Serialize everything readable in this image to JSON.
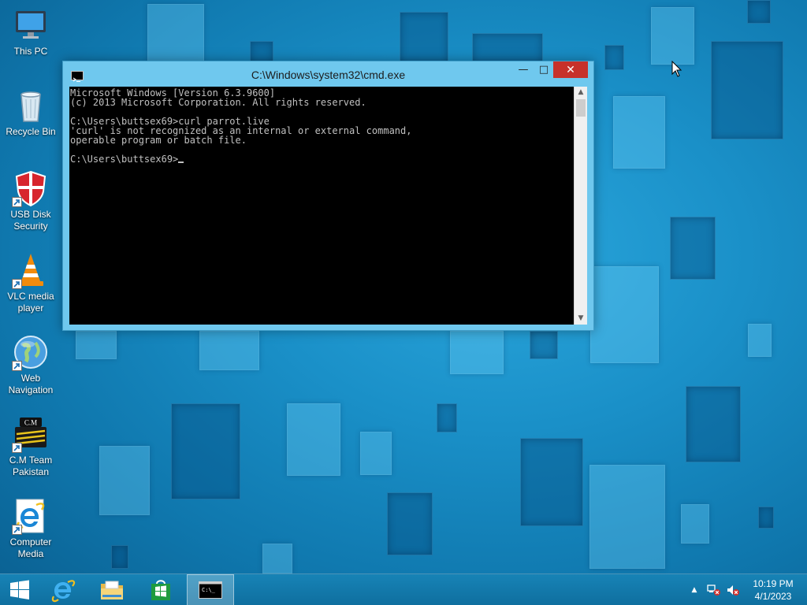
{
  "desktop": {
    "icons": [
      {
        "label_lines": [
          "This PC"
        ],
        "icon": "computer-icon",
        "shortcut": false
      },
      {
        "label_lines": [
          "Recycle Bin"
        ],
        "icon": "recycle-bin-icon",
        "shortcut": false
      },
      {
        "label_lines": [
          "USB Disk",
          "Security"
        ],
        "icon": "shield-icon",
        "shortcut": true
      },
      {
        "label_lines": [
          "VLC media",
          "player"
        ],
        "icon": "vlc-cone-icon",
        "shortcut": true
      },
      {
        "label_lines": [
          "Web",
          "Navigation"
        ],
        "icon": "globe-icon",
        "shortcut": true
      },
      {
        "label_lines": [
          "C.M Team",
          "Pakistan"
        ],
        "icon": "cm-team-logo-icon",
        "shortcut": true,
        "logo_text": "C.M"
      },
      {
        "label_lines": [
          "Computer",
          "Media"
        ],
        "icon": "internet-explorer-icon",
        "shortcut": true
      }
    ]
  },
  "window": {
    "title": "C:\\Windows\\system32\\cmd.exe",
    "buttons": {
      "minimize": "—",
      "maximize": "□",
      "close": "✕"
    },
    "colors": {
      "frame": "#6fc8ee",
      "close_button": "#c7312b",
      "console_bg": "#000000",
      "console_text": "#c0c0c0"
    },
    "console_lines": [
      "Microsoft Windows [Version 6.3.9600]",
      "(c) 2013 Microsoft Corporation. All rights reserved.",
      "",
      "C:\\Users\\buttsex69>curl parrot.live",
      "'curl' is not recognized as an internal or external command,",
      "operable program or batch file.",
      "",
      "C:\\Users\\buttsex69>"
    ]
  },
  "taskbar": {
    "pinned": [
      "windows-start-icon",
      "internet-explorer-icon",
      "file-explorer-icon",
      "store-icon",
      "cmd-icon"
    ],
    "active": "cmd-icon",
    "cmd_icon_text": "C:\\_",
    "tray": {
      "show_hidden": "▲",
      "network_icon": "network-error-icon",
      "volume_icon": "volume-muted-icon"
    },
    "clock": {
      "time": "10:19 PM",
      "date": "4/1/2023"
    }
  },
  "theme": {
    "accent": "#1a90c8",
    "taskbar": "#1380b3"
  }
}
